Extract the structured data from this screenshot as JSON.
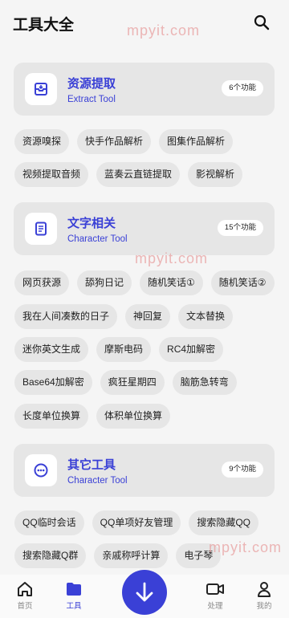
{
  "header": {
    "title": "工具大全"
  },
  "watermark": "mpyit.com",
  "sections": [
    {
      "title": "资源提取",
      "subtitle": "Extract Tool",
      "count": "6个功能",
      "icon": "archive-icon",
      "rows": [
        [
          "资源嗅探",
          "快手作品解析",
          "图集作品解析"
        ],
        [
          "视频提取音频",
          "蓝奏云直链提取",
          "影视解析"
        ]
      ]
    },
    {
      "title": "文字相关",
      "subtitle": "Character Tool",
      "count": "15个功能",
      "icon": "document-icon",
      "rows": [
        [
          "网页获源",
          "舔狗日记",
          "随机笑话①",
          "随机笑话②"
        ],
        [
          "我在人间凑数的日子",
          "神回复",
          "文本替换"
        ],
        [
          "迷你英文生成",
          "摩斯电码",
          "RC4加解密"
        ],
        [
          "Base64加解密",
          "疯狂星期四",
          "脑筋急转弯"
        ],
        [
          "长度单位换算",
          "体积单位换算"
        ]
      ]
    },
    {
      "title": "其它工具",
      "subtitle": "Character Tool",
      "count": "9个功能",
      "icon": "more-icon",
      "rows": [
        [
          "QQ临时会话",
          "QQ单项好友管理",
          "搜索隐藏QQ"
        ],
        [
          "搜索隐藏Q群",
          "亲戚称呼计算",
          "电子琴"
        ]
      ]
    }
  ],
  "tabbar": {
    "tabs": [
      {
        "label": "首页",
        "icon": "home-icon",
        "active": false
      },
      {
        "label": "工具",
        "icon": "folder-icon",
        "active": true
      },
      {
        "label": "处理",
        "icon": "video-camera-icon",
        "active": false
      },
      {
        "label": "我的",
        "icon": "person-icon",
        "active": false
      }
    ],
    "fab_icon": "download-arrow-icon"
  },
  "colors": {
    "accent": "#3a40d6",
    "card_bg": "#e6e6e6",
    "page_bg": "#f5f5f5"
  }
}
